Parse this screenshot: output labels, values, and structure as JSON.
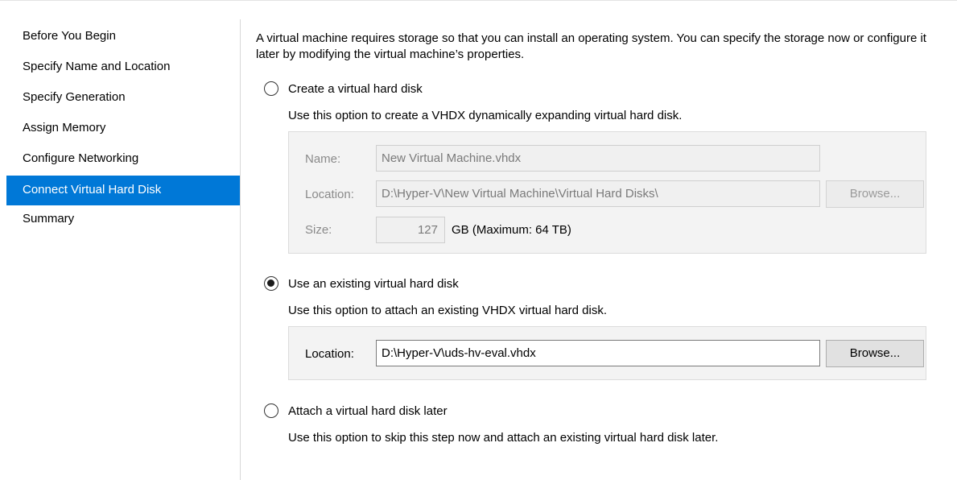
{
  "nav": {
    "items": [
      {
        "label": "Before You Begin"
      },
      {
        "label": "Specify Name and Location"
      },
      {
        "label": "Specify Generation"
      },
      {
        "label": "Assign Memory"
      },
      {
        "label": "Configure Networking"
      },
      {
        "label": "Connect Virtual Hard Disk"
      },
      {
        "label": "Summary"
      }
    ],
    "active_index": 5
  },
  "intro": "A virtual machine requires storage so that you can install an operating system. You can specify the storage now or configure it later by modifying the virtual machine’s properties.",
  "options": {
    "create": {
      "label": "Create a virtual hard disk",
      "description": "Use this option to create a VHDX dynamically expanding virtual hard disk.",
      "selected": false,
      "name_label": "Name:",
      "name_value": "New Virtual Machine.vhdx",
      "location_label": "Location:",
      "location_value": "D:\\Hyper-V\\New Virtual Machine\\Virtual Hard Disks\\",
      "browse_label": "Browse...",
      "size_label": "Size:",
      "size_value": "127",
      "size_unit": "GB (Maximum: 64 TB)"
    },
    "existing": {
      "label": "Use an existing virtual hard disk",
      "description": "Use this option to attach an existing VHDX virtual hard disk.",
      "selected": true,
      "location_label": "Location:",
      "location_value": "D:\\Hyper-V\\uds-hv-eval.vhdx",
      "browse_label": "Browse..."
    },
    "later": {
      "label": "Attach a virtual hard disk later",
      "description": "Use this option to skip this step now and attach an existing virtual hard disk later.",
      "selected": false
    }
  },
  "colors": {
    "accent": "#0078d7",
    "panel": "#f3f3f3"
  }
}
